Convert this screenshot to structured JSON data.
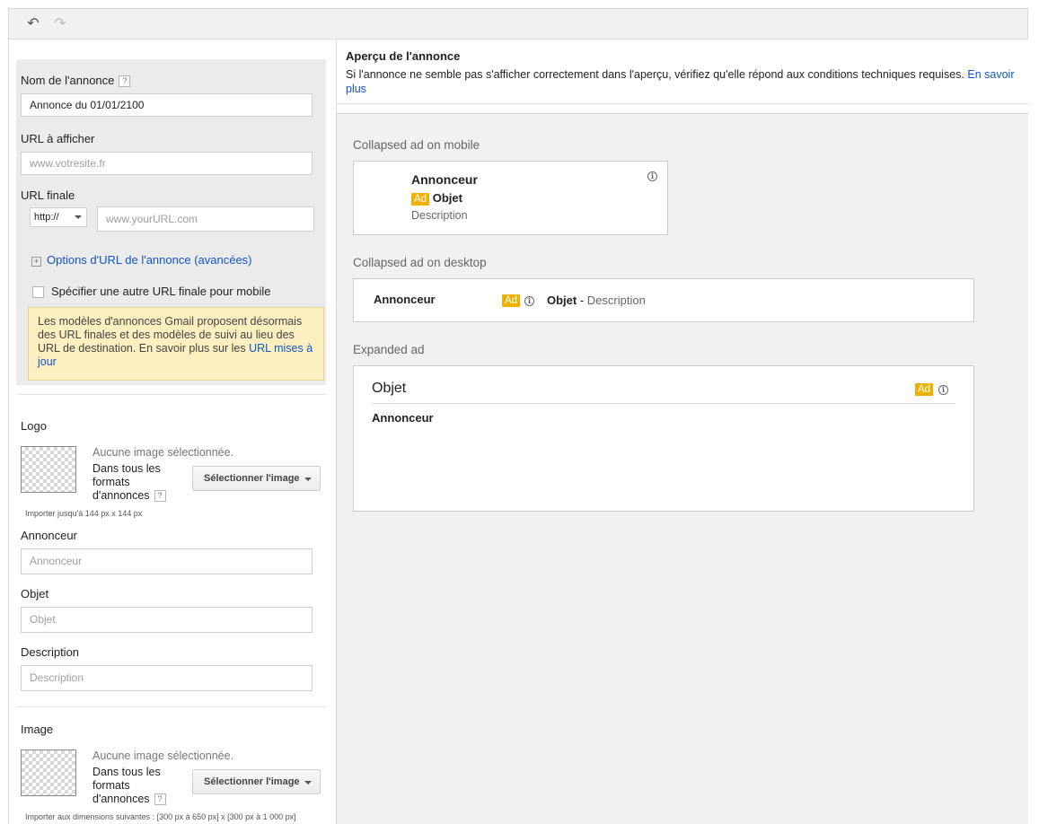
{
  "toolbar": {
    "undo_icon": "undo-icon",
    "redo_icon": "redo-icon",
    "undo_glyph": "↶",
    "redo_glyph": "↷"
  },
  "form": {
    "ad_name": {
      "label": "Nom de l'annonce",
      "help": "?",
      "value": "Annonce du 01/01/2100"
    },
    "display_url": {
      "label": "URL à afficher",
      "placeholder": "www.votresite.fr"
    },
    "final_url": {
      "label": "URL finale",
      "protocol": "http://",
      "placeholder": "www.yourURL.com"
    },
    "url_options": {
      "plus": "+",
      "label": "Options d'URL de l'annonce (avancées)"
    },
    "mobile_url_checkbox": "Spécifier une autre URL finale pour mobile",
    "notice": {
      "text": "Les modèles d'annonces Gmail proposent désormais des URL finales et des modèles de suivi au lieu des URL de destination. En savoir plus sur les ",
      "link": "URL mises à jour"
    },
    "logo": {
      "label": "Logo",
      "no_image": "Aucune image sélectionnée.",
      "formats": "Dans tous les formats d'annonces",
      "help": "?",
      "button": "Sélectionner l'image",
      "hint": "Importer jusqu'à 144 px x 144 px"
    },
    "advertiser": {
      "label": "Annonceur",
      "placeholder": "Annonceur"
    },
    "subject": {
      "label": "Objet",
      "placeholder": "Objet"
    },
    "description": {
      "label": "Description",
      "placeholder": "Description"
    },
    "image": {
      "label": "Image",
      "no_image": "Aucune image sélectionnée.",
      "formats": "Dans tous les formats d'annonces",
      "help": "?",
      "button": "Sélectionner l'image",
      "hint": "Importer aux dimensions suivantes : [300 px à 650 px] x [300 px à 1 000 px]"
    }
  },
  "preview": {
    "title": "Aperçu de l'annonce",
    "subtitle": "Si l'annonce ne semble pas s'afficher correctement dans l'aperçu, vérifiez qu'elle répond aux conditions techniques requises.",
    "learn_more": "En savoir plus",
    "badge": "Ad",
    "info": "i",
    "mobile": {
      "title": "Collapsed ad on mobile",
      "advertiser": "Annonceur",
      "subject": "Objet",
      "description": "Description"
    },
    "desktop": {
      "title": "Collapsed ad on desktop",
      "advertiser": "Annonceur",
      "subject": "Objet",
      "separator": " - ",
      "description": "Description"
    },
    "expanded": {
      "title": "Expanded ad",
      "subject": "Objet",
      "advertiser": "Annonceur"
    }
  },
  "colors": {
    "accent_link": "#1155cc",
    "ad_badge": "#f0b000",
    "notice_bg": "#fcf0c0"
  }
}
